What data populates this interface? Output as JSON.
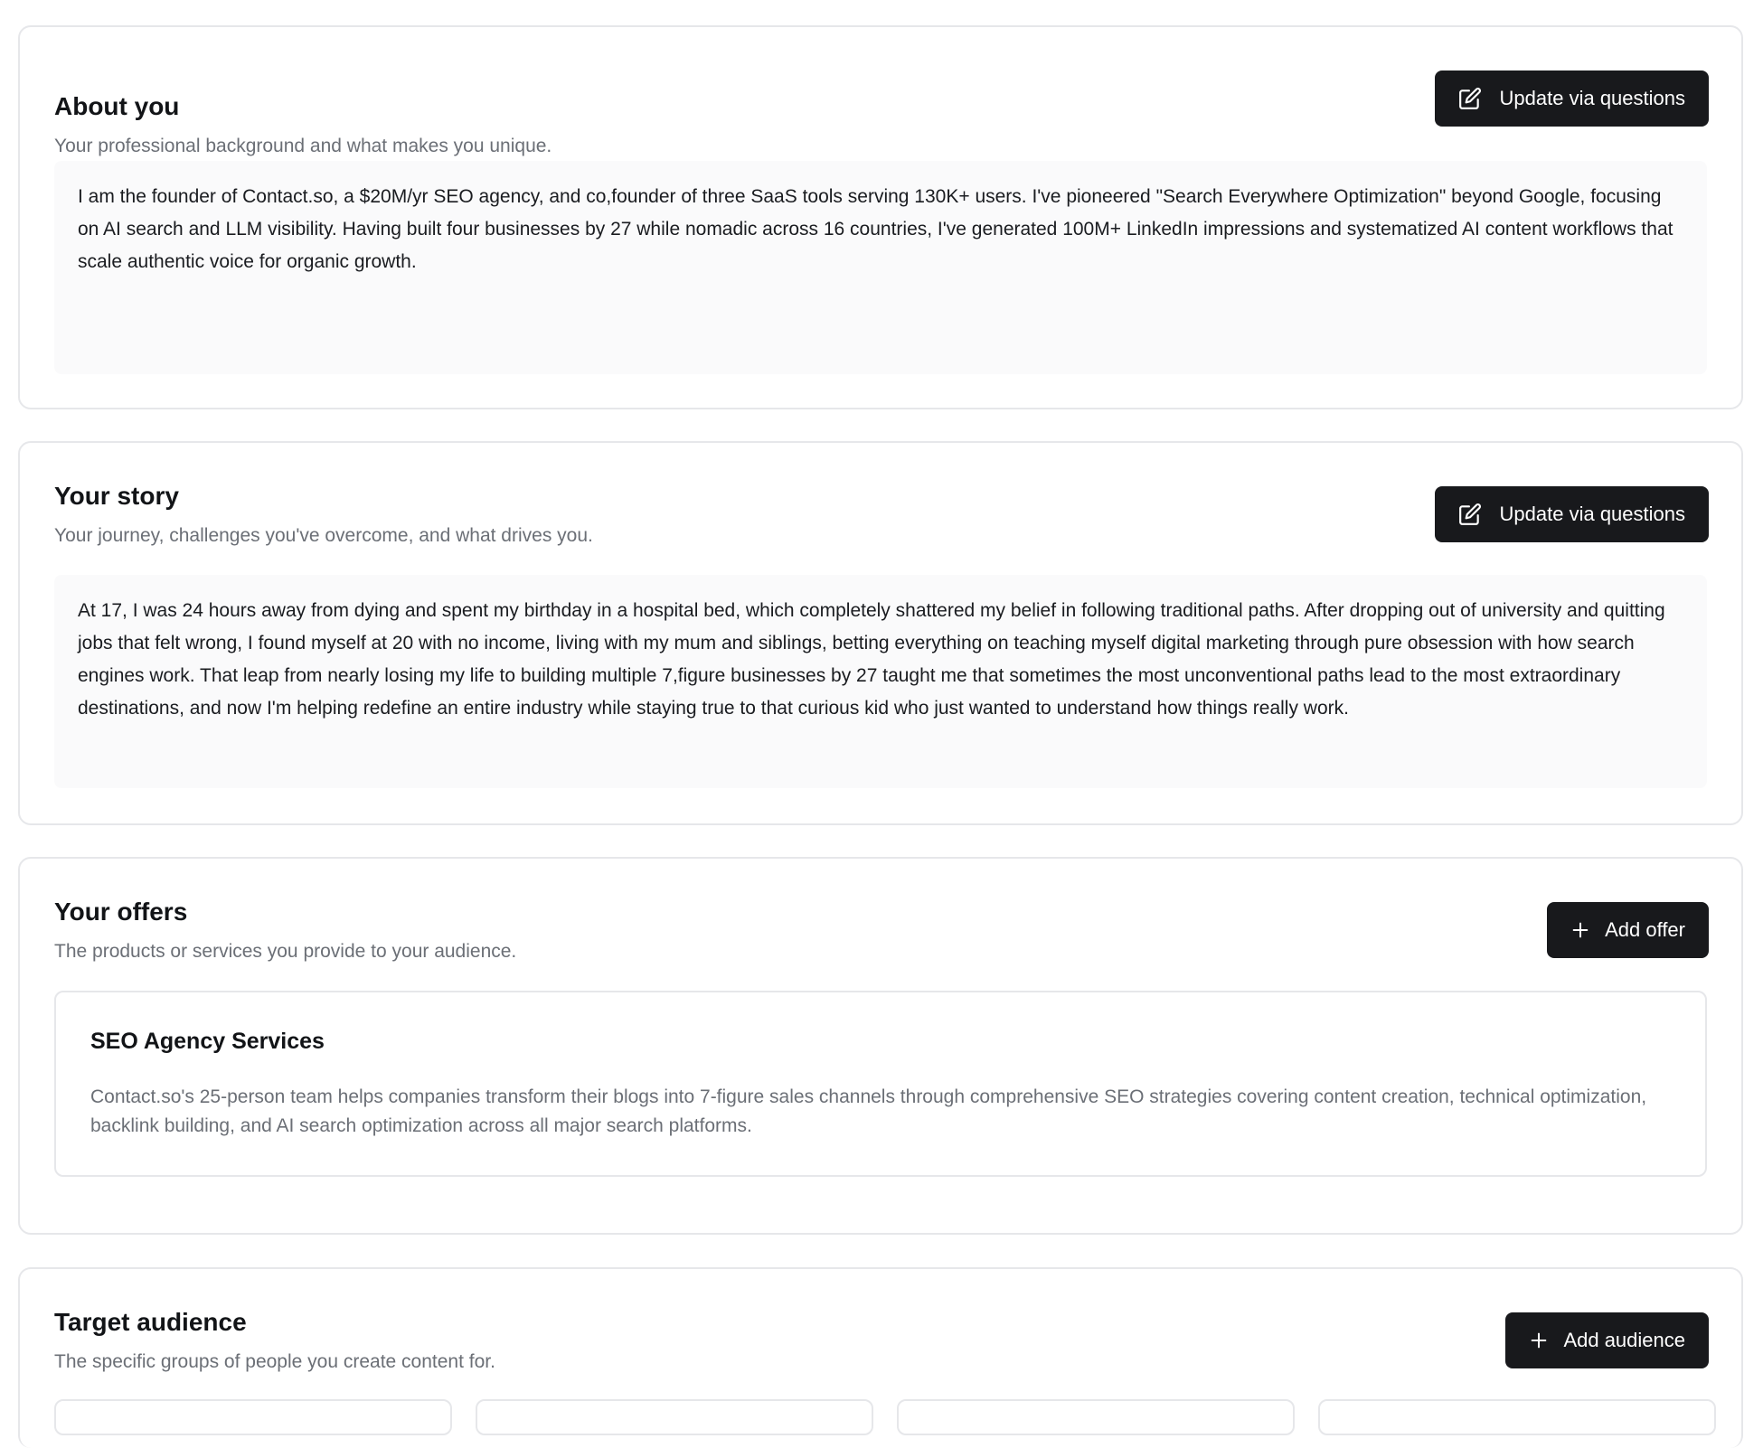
{
  "about": {
    "title": "About you",
    "subtitle": "Your professional background and what makes you unique.",
    "button_label": "Update via questions",
    "button_icon": "edit-icon",
    "text": "I am the founder of Contact.so, a $20M/yr SEO agency, and co,founder of three SaaS tools serving 130K+ users. I've pioneered \"Search Everywhere Optimization\" beyond Google, focusing on AI search and LLM visibility. Having built four businesses by 27 while nomadic across 16 countries, I've generated 100M+ LinkedIn impressions and systematized AI content workflows that scale authentic voice for organic growth."
  },
  "story": {
    "title": "Your story",
    "subtitle": "Your journey, challenges you've overcome, and what drives you.",
    "button_label": "Update via questions",
    "button_icon": "edit-icon",
    "text": "At 17, I was 24 hours away from dying and spent my birthday in a hospital bed, which completely shattered my belief in following traditional paths. After dropping out of university and quitting jobs that felt wrong, I found myself at 20 with no income, living with my mum and siblings, betting everything on teaching myself digital marketing through pure obsession with how search engines work. That leap from nearly losing my life to building multiple 7,figure businesses by 27 taught me that sometimes the most unconventional paths lead to the most extraordinary destinations, and now I'm helping redefine an entire industry while staying true to that curious kid who just wanted to understand how things really work."
  },
  "offers": {
    "title": "Your offers",
    "subtitle": "The products or services you provide to your audience.",
    "button_label": "Add offer",
    "button_icon": "plus-icon",
    "items": [
      {
        "title": "SEO Agency Services",
        "description": "Contact.so's 25-person team helps companies transform their blogs into 7-figure sales channels through comprehensive SEO strategies covering content creation, technical optimization, backlink building, and AI search optimization across all major search platforms."
      }
    ]
  },
  "audience": {
    "title": "Target audience",
    "subtitle": "The specific groups of people you create content for.",
    "button_label": "Add audience",
    "button_icon": "plus-icon"
  },
  "colors": {
    "button_bg": "#18191c",
    "card_border": "#e6e7ea",
    "text_box_bg": "#fafafb",
    "subtitle_text": "#6b6f76"
  }
}
